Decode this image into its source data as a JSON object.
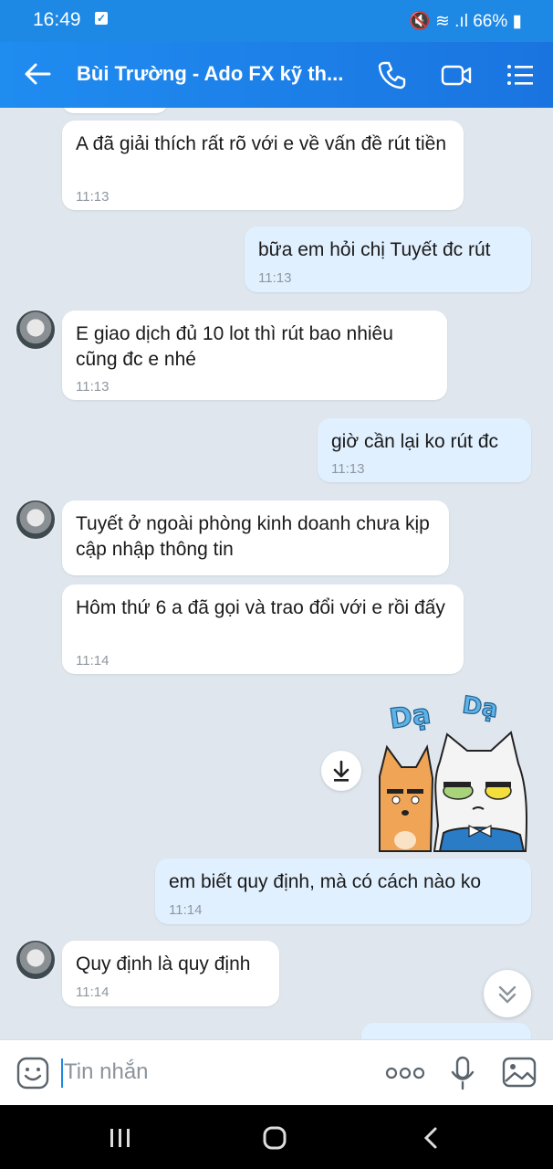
{
  "status": {
    "time": "16:49",
    "battery": "66%"
  },
  "header": {
    "title": "Bùi Trường - Ado FX kỹ th..."
  },
  "messages": [
    {
      "text": "A đã giải thích rất rõ với e về vấn đề rút tiền",
      "time": "11:13"
    },
    {
      "text": "bữa em hỏi chị Tuyết đc rút",
      "time": "11:13"
    },
    {
      "text": "E giao dịch đủ 10 lot thì rút bao nhiêu cũng đc e nhé",
      "time": "11:13"
    },
    {
      "text": "giờ cần lại ko rút đc",
      "time": "11:13"
    },
    {
      "text": "Tuyết ở ngoài phòng kinh doanh chưa kịp cập nhập thông tin"
    },
    {
      "text": "Hôm thứ 6 a đã gọi và trao đổi với e rồi đấy",
      "time": "11:14"
    },
    {
      "text": "em biết quy định, mà có cách nào ko",
      "time": "11:14"
    },
    {
      "text": "Quy định là quy định",
      "time": "11:14"
    }
  ],
  "sticker": {
    "text_left": "Dạ",
    "text_right": "Dạ"
  },
  "input": {
    "placeholder": "Tin nhắn"
  },
  "colors": {
    "accent": "#1e88e5",
    "chat_bg": "#dfe6ee",
    "my_bubble": "#e1f0ff"
  }
}
